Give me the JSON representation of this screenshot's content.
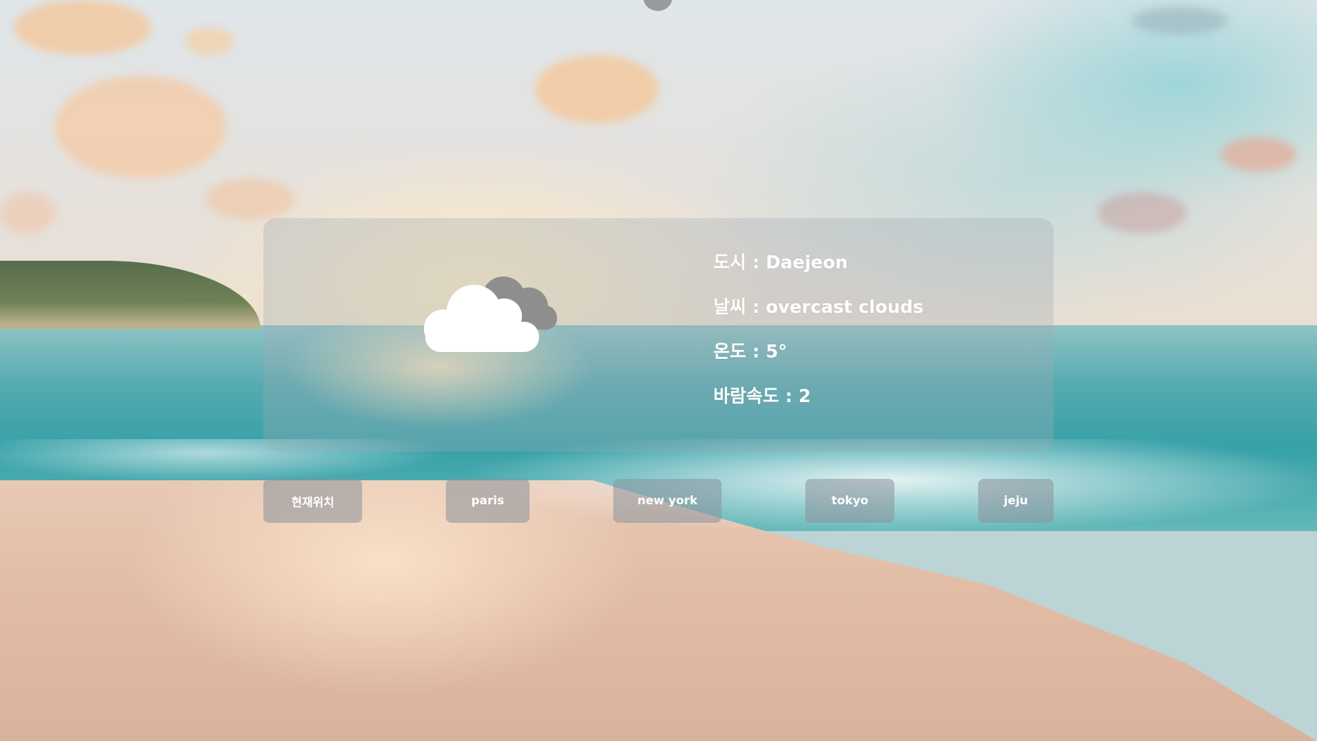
{
  "weather": {
    "city_label": "도시 : Daejeon",
    "description_label": "날씨 : overcast clouds",
    "temperature_label": "온도 : 5°",
    "wind_speed_label": "바람속도 : 2",
    "icon": "overcast-clouds-icon"
  },
  "city_buttons": [
    {
      "label": "현재위치"
    },
    {
      "label": "paris"
    },
    {
      "label": "new york"
    },
    {
      "label": "tokyo"
    },
    {
      "label": "jeju"
    }
  ],
  "colors": {
    "card_bg": "rgba(160,170,180,0.32)",
    "button_bg": "rgba(139,146,154,0.55)",
    "text": "#ffffff"
  }
}
